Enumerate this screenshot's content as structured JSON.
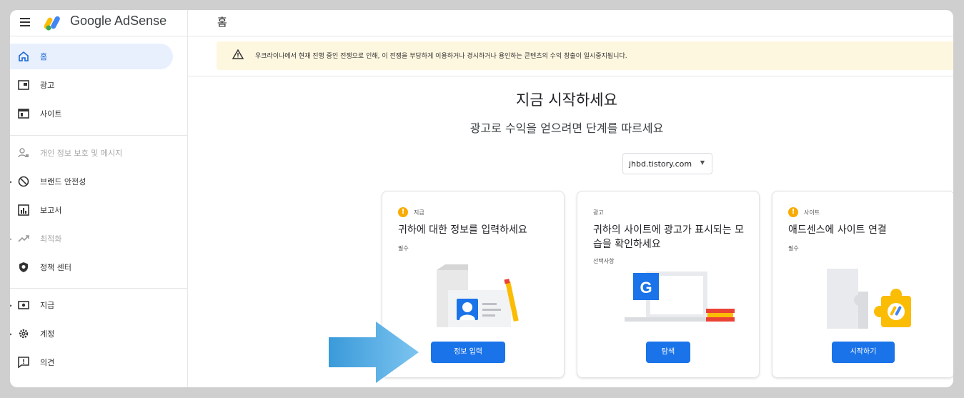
{
  "header": {
    "brand": "Google AdSense",
    "page_title": "홈"
  },
  "sidebar": {
    "items": [
      {
        "label": "홈",
        "icon": "home-icon"
      },
      {
        "label": "광고",
        "icon": "ads-icon"
      },
      {
        "label": "사이트",
        "icon": "sites-icon"
      },
      {
        "label": "개인 정보 보호 및 메시지",
        "icon": "privacy-icon"
      },
      {
        "label": "브랜드 안전성",
        "icon": "block-icon"
      },
      {
        "label": "보고서",
        "icon": "reports-icon"
      },
      {
        "label": "최적화",
        "icon": "trend-icon"
      },
      {
        "label": "정책 센터",
        "icon": "shield-icon"
      },
      {
        "label": "지급",
        "icon": "payments-icon"
      },
      {
        "label": "계정",
        "icon": "gear-icon"
      },
      {
        "label": "의견",
        "icon": "feedback-icon"
      }
    ]
  },
  "banner": {
    "text": "우크라이나에서 현재 진행 중인 전쟁으로 인해, 이 전쟁을 부당하게 이용하거나 경시하거나 용인하는 콘텐츠의 수익 창출이 일시중지됩니다."
  },
  "main": {
    "headline": "지금 시작하세요",
    "subheadline": "광고로 수익을 얻으려면 단계를 따르세요",
    "site_select": "jhbd.tistory.com"
  },
  "cards": [
    {
      "tag": "지급",
      "title": "귀하에 대한 정보를 입력하세요",
      "requirement": "필수",
      "button": "정보 입력"
    },
    {
      "tag": "광고",
      "title": "귀하의 사이트에 광고가 표시되는 모습을 확인하세요",
      "requirement": "선택사항",
      "button": "탐색"
    },
    {
      "tag": "사이트",
      "title": "애드센스에 사이트 연결",
      "requirement": "필수",
      "button": "시작하기"
    }
  ],
  "colors": {
    "accent": "#1a73e8",
    "warning": "#f9ab00",
    "banner_bg": "#fef7e0",
    "active_nav_bg": "#e8f0fe"
  }
}
